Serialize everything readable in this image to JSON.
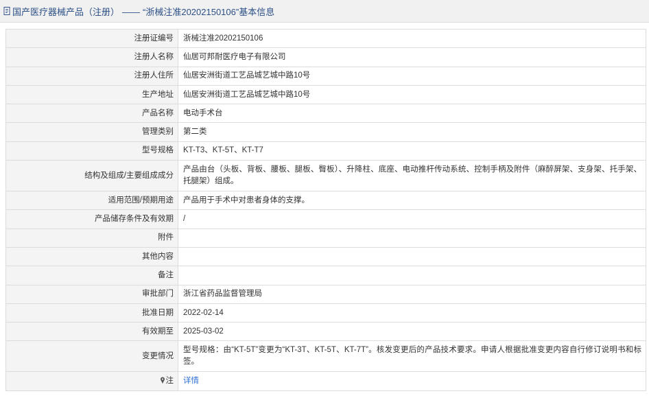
{
  "header": {
    "icon": "document-icon",
    "breadcrumb": "国产医疗器械产品（注册）",
    "separator": "——",
    "record_title": "“浙械注准20202150106”基本信息"
  },
  "details": {
    "rows": [
      {
        "label": "注册证编号",
        "value": "浙械注准20202150106"
      },
      {
        "label": "注册人名称",
        "value": "仙居可邦耐医疗电子有限公司"
      },
      {
        "label": "注册人住所",
        "value": "仙居安洲街道工艺品城艺城中路10号"
      },
      {
        "label": "生产地址",
        "value": "仙居安洲街道工艺品城艺城中路10号"
      },
      {
        "label": "产品名称",
        "value": "电动手术台"
      },
      {
        "label": "管理类别",
        "value": "第二类"
      },
      {
        "label": "型号规格",
        "value": "KT-T3、KT-5T、KT-T7"
      },
      {
        "label": "结构及组成/主要组成成分",
        "value": "产品由台（头板、背板、腰板、腿板、臀板）、升降柱、底座、电动推杆传动系统、控制手柄及附件（麻醉屏架、支身架、托手架、托腿架）组成。"
      },
      {
        "label": "适用范围/预期用途",
        "value": "产品用于手术中对患者身体的支撑。"
      },
      {
        "label": "产品储存条件及有效期",
        "value": "/"
      },
      {
        "label": "附件",
        "value": ""
      },
      {
        "label": "其他内容",
        "value": ""
      },
      {
        "label": "备注",
        "value": ""
      },
      {
        "label": "审批部门",
        "value": "浙江省药品监督管理局"
      },
      {
        "label": "批准日期",
        "value": "2022-02-14"
      },
      {
        "label": "有效期至",
        "value": "2025-03-02"
      },
      {
        "label": "变更情况",
        "value": "型号规格：由“KT-5T”变更为“KT-3T、KT-5T、KT-7T”。核发变更后的产品技术要求。申请人根据批准变更内容自行修订说明书和标签。"
      }
    ],
    "note": {
      "icon": "pin-icon",
      "label": "注",
      "link_text": "详情"
    }
  },
  "colors": {
    "title_text": "#2b4f86",
    "label_bg": "#f4f4f4",
    "border": "#dcdcdc",
    "link": "#2e6fd6"
  }
}
